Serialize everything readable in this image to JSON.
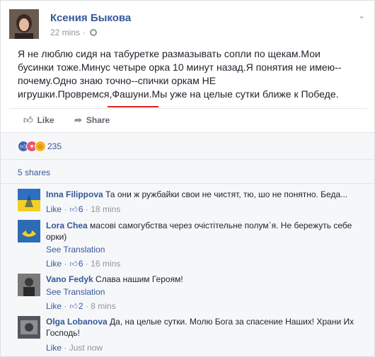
{
  "post": {
    "author": "Ксения Быкова",
    "time": "22 mins",
    "lines": [
      "Я не люблю сидя на табуретке размазывать сопли по щекам.Мои",
      "бусинки тоже.Минус четыре орка 10 минут назад.Я понятия не имею--",
      "почему.Одно знаю точно--спички оркам НЕ",
      "игрушки.Провремся,Фашуни.Мы уже на целые сутки ближе к Победе."
    ]
  },
  "actions": {
    "like": "Like",
    "share": "Share"
  },
  "reactions": {
    "count": "235",
    "icons": [
      "like",
      "love",
      "haha"
    ]
  },
  "shares": "5 shares",
  "comments": [
    {
      "name": "Inna Filippova",
      "text": "Та они ж ружбайки свои не чистят, тю, шо не понятно. Беда...",
      "translation": "",
      "like": "Like",
      "likes": "6",
      "time": "18 mins"
    },
    {
      "name": "Lora Chea",
      "text": "масові самогубства через очістітельне полум`я. Не бережуть себе орки)",
      "translation": "See Translation",
      "like": "Like",
      "likes": "6",
      "time": "16 mins"
    },
    {
      "name": "Vano Fedyk",
      "text": "Слава нашим Героям!",
      "translation": "See Translation",
      "like": "Like",
      "likes": "2",
      "time": "8 mins"
    },
    {
      "name": "Olga Lobanova",
      "text": "Да, на целые сутки. Молю Бога за спасение Наших! Храни Их Господь!",
      "translation": "",
      "like": "Like",
      "likes": "",
      "time": "Just now"
    }
  ],
  "colors": {
    "link": "#365899",
    "underline": "#e0201b",
    "background": "#f6f7f9"
  }
}
